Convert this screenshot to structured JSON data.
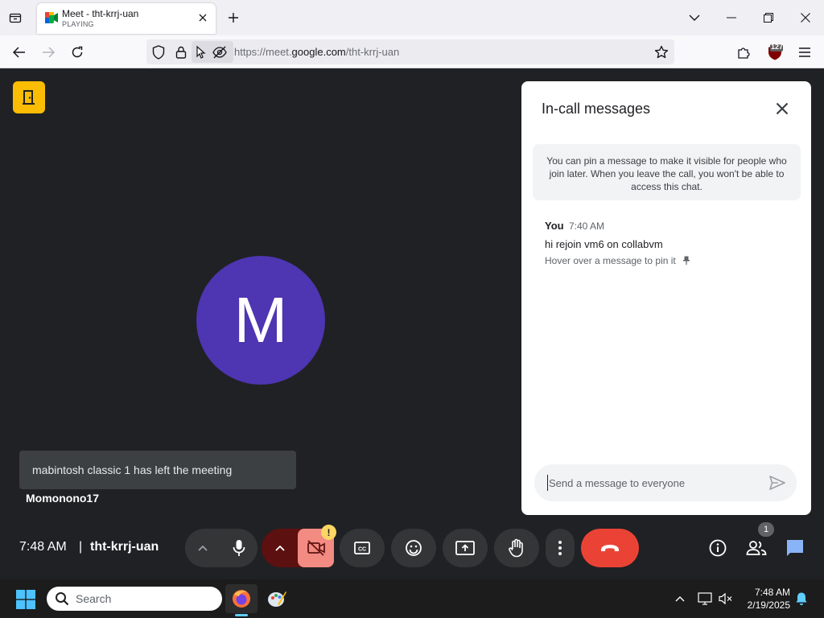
{
  "browser": {
    "tab": {
      "title": "Meet - tht-krrj-uan",
      "status": "PLAYING"
    },
    "address": {
      "prefix": "https://meet.",
      "domain": "google.com",
      "path": "/tht-krrj-uan"
    },
    "extension_badge": "127"
  },
  "meet": {
    "avatar_letter": "M",
    "toast": "mabintosh classic 1 has left the meeting",
    "participant_name": "Momonono17",
    "meeting_time": "7:48 AM",
    "separator": "|",
    "meeting_code": "tht-krrj-uan",
    "warning_badge": "!",
    "people_count": "1",
    "colors": {
      "background": "#202124",
      "avatar": "#4e35b1",
      "leave": "#ea4335",
      "accent": "#fbbc04",
      "chat_icon": "#8ab4f8"
    }
  },
  "chat": {
    "title": "In-call messages",
    "info": "You can pin a message to make it visible for people who join later. When you leave the call, you won't be able to access this chat.",
    "message": {
      "sender": "You",
      "time": "7:40 AM",
      "text": "hi rejoin vm6 on collabvm",
      "hint": "Hover over a message to pin it"
    },
    "input_placeholder": "Send a message to everyone"
  },
  "taskbar": {
    "search_label": "Search",
    "clock_time": "7:48 AM",
    "clock_date": "2/19/2025"
  }
}
